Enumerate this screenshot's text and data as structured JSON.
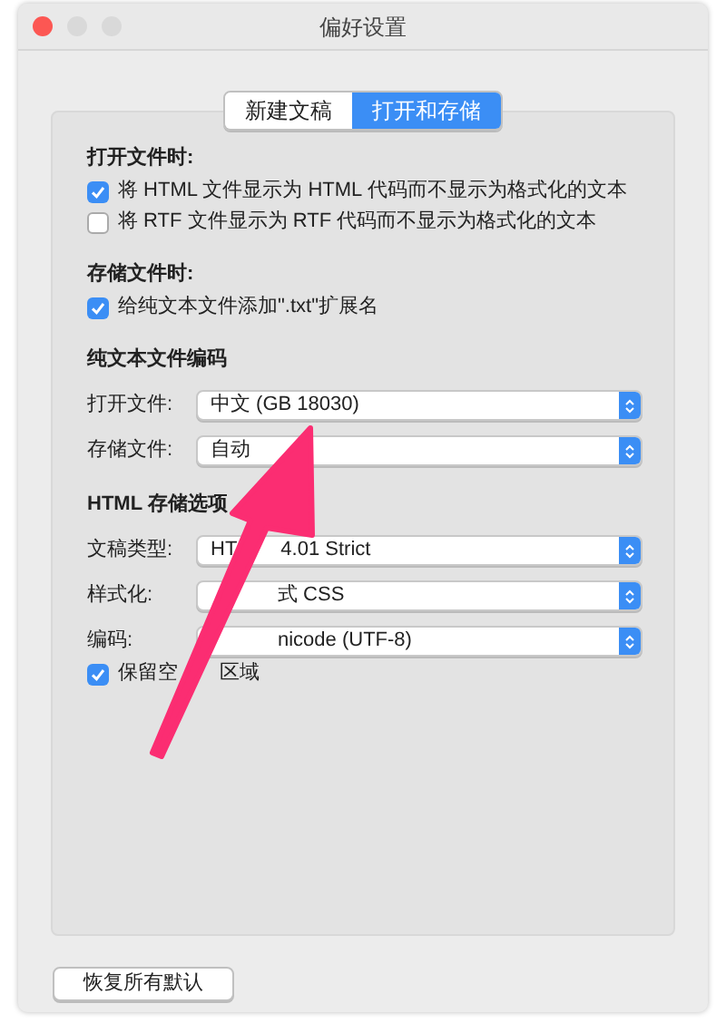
{
  "window": {
    "title": "偏好设置"
  },
  "tabs": [
    {
      "label": "新建文稿",
      "selected": false
    },
    {
      "label": "打开和存储",
      "selected": true
    }
  ],
  "sections": [
    {
      "title": "打开文件时:",
      "items": [
        {
          "kind": "checkbox",
          "checked": true,
          "parts": [
            "将 HTML 文件显示为 HTML 代码而不显示为格式化的文本"
          ]
        },
        {
          "kind": "checkbox",
          "checked": false,
          "parts": [
            "将 RTF 文件显示为 RTF 代码而不显示为格式化的文本"
          ]
        }
      ]
    },
    {
      "title": "存储文件时:",
      "items": [
        {
          "kind": "checkbox",
          "checked": true,
          "parts": [
            "给纯文本文件添加\".txt\"扩展名"
          ]
        }
      ]
    },
    {
      "title": "纯文本文件编码",
      "items": [
        {
          "kind": "popup",
          "label": "打开文件:",
          "parts": [
            "中文 (GB 18030)"
          ]
        },
        {
          "kind": "popup",
          "label": "存储文件:",
          "parts": [
            "自动"
          ]
        }
      ]
    },
    {
      "title": "HTML 存储选项",
      "items": [
        {
          "kind": "popup",
          "label": "文稿类型:",
          "parts": [
            "HT",
            "4.01 Strict"
          ]
        },
        {
          "kind": "popup",
          "label": "样式化:",
          "covered_start": true,
          "parts": [
            "式 CSS"
          ]
        },
        {
          "kind": "popup",
          "label": "编码:",
          "covered_start": true,
          "parts": [
            "nicode (UTF-8)"
          ]
        },
        {
          "kind": "checkbox",
          "checked": true,
          "parts": [
            "保留空",
            "区域"
          ]
        }
      ]
    }
  ],
  "reset_button": "恢复所有默认"
}
